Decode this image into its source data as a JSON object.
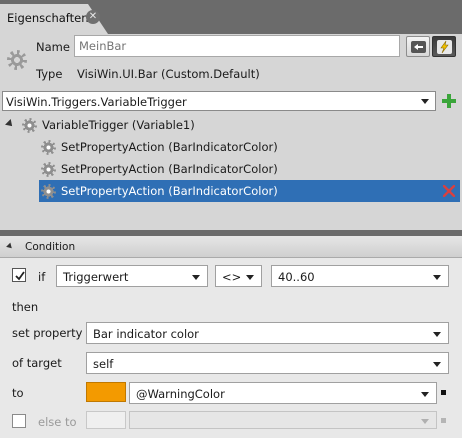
{
  "tab": {
    "title": "Eigenschaften",
    "close_icon": "close-icon"
  },
  "header": {
    "name_label": "Name",
    "name_placeholder": "MeinBar",
    "type_label": "Type",
    "type_value": "VisiWin.UI.Bar (Custom.Default)"
  },
  "triggers": {
    "selected_trigger": "VisiWin.Triggers.VariableTrigger",
    "tree": {
      "root_label": "VariableTrigger (Variable1)",
      "actions": [
        {
          "label": "SetPropertyAction (BarIndicatorColor)"
        },
        {
          "label": "SetPropertyAction (BarIndicatorColor)"
        },
        {
          "label": "SetPropertyAction (BarIndicatorColor)"
        }
      ]
    }
  },
  "condition": {
    "section_title": "Condition",
    "if_label": "if",
    "if_checked": true,
    "source": "Triggerwert",
    "operator": "<>",
    "value": "40..60",
    "then_label": "then",
    "set_property_label": "set property",
    "property": "Bar indicator color",
    "of_target_label": "of target",
    "target": "self",
    "to_label": "to",
    "to_color": "#f39a00",
    "to_value": "@WarningColor",
    "else_to_label": "else to",
    "else_checked": false
  },
  "colors": {
    "selection": "#2f6fb5",
    "add_icon": "#3aa53a",
    "delete_icon": "#d84040",
    "warning_swatch": "#f39a00"
  }
}
